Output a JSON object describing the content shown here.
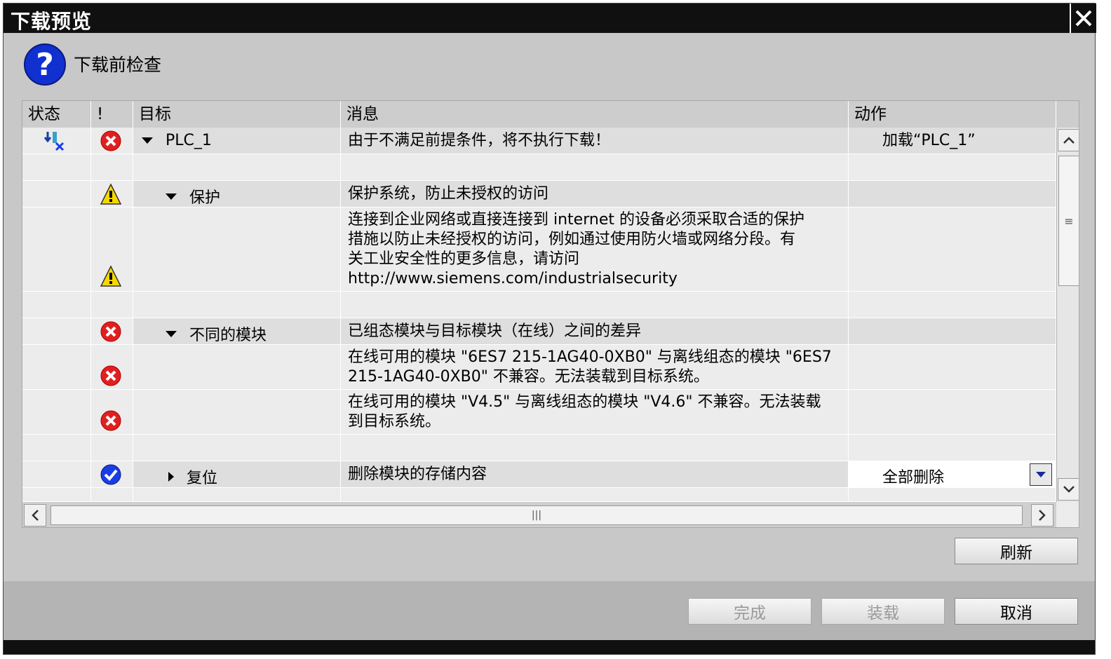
{
  "window": {
    "title": "下载预览"
  },
  "header": {
    "text": "下载前检查"
  },
  "columns": {
    "state": "状态",
    "excl": "!",
    "target": "目标",
    "message": "消息",
    "action": "动作"
  },
  "rows": [
    {
      "target": "PLC_1",
      "message": "由于不满足前提条件，将不执行下载！",
      "action": "加载“PLC_1”"
    },
    {
      "target": "",
      "message": "",
      "action": ""
    },
    {
      "target": "保护",
      "message": "保护系统，防止未授权的访问",
      "action": ""
    },
    {
      "target": "",
      "message_lines": [
        "连接到企业网络或直接连接到 internet 的设备必须采取合适的保护",
        "措施以防止未经授权的访问，例如通过使用防火墙或网络分段。有",
        "关工业安全性的更多信息，请访问",
        "http://www.siemens.com/industrialsecurity"
      ],
      "action": ""
    },
    {
      "target": "",
      "message": "",
      "action": ""
    },
    {
      "target": "不同的模块",
      "message": "已组态模块与目标模块（在线）之间的差异",
      "action": ""
    },
    {
      "target": "",
      "message_lines": [
        "在线可用的模块 \"6ES7 215-1AG40-0XB0\" 与离线组态的模块 \"6ES7",
        "215-1AG40-0XB0\" 不兼容。无法装载到目标系统。"
      ],
      "action": ""
    },
    {
      "target": "",
      "message_lines": [
        "在线可用的模块 \"V4.5\" 与离线组态的模块 \"V4.6\" 不兼容。无法装载",
        "到目标系统。"
      ],
      "action": ""
    },
    {
      "target": "",
      "message": "",
      "action": ""
    },
    {
      "target": "复位",
      "message": "删除模块的存储内容",
      "action": "全部删除"
    }
  ],
  "buttons": {
    "refresh": "刷新",
    "finish": "完成",
    "load": "装载",
    "cancel": "取消"
  },
  "colors": {
    "error": "#e02020",
    "warning": "#f5d800",
    "ok": "#1a3ee6",
    "question": "#1030d0",
    "titlebar": "#101010"
  },
  "icons": {
    "header": "question-icon",
    "plc_state": "download-error-icon"
  }
}
